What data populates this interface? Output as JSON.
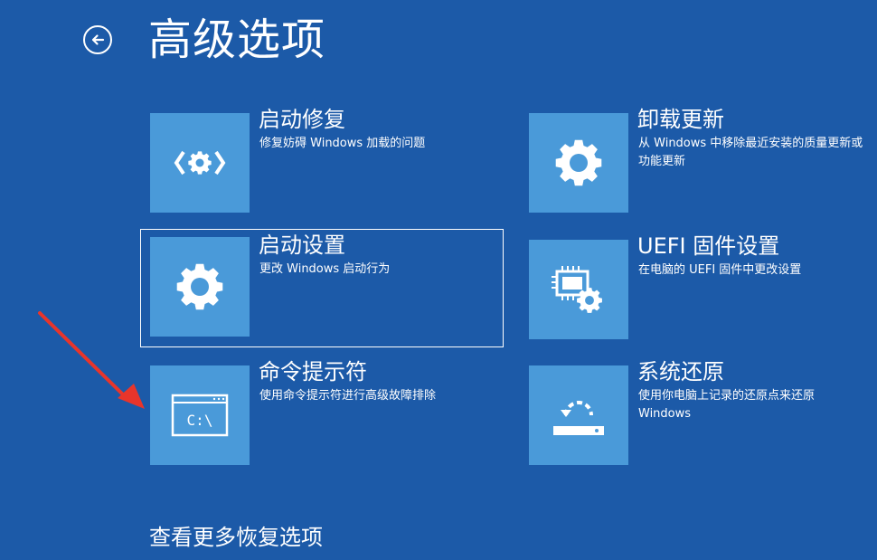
{
  "header": {
    "back_icon": "back-arrow-circle-icon",
    "title": "高级选项"
  },
  "options": [
    {
      "title": "启动修复",
      "desc": "修复妨碍 Windows 加载的问题",
      "icon": "startup-repair-icon"
    },
    {
      "title": "卸载更新",
      "desc": "从 Windows 中移除最近安装的质量更新或功能更新",
      "icon": "gear-icon"
    },
    {
      "title": "启动设置",
      "desc": "更改 Windows 启动行为",
      "icon": "gear-icon"
    },
    {
      "title": "UEFI 固件设置",
      "desc": "在电脑的 UEFI 固件中更改设置",
      "icon": "chip-gear-icon"
    },
    {
      "title": "命令提示符",
      "desc": "使用命令提示符进行高级故障排除",
      "icon": "command-prompt-icon",
      "icon_text": "C:\\"
    },
    {
      "title": "系统还原",
      "desc": "使用你电脑上记录的还原点来还原 Windows",
      "icon": "system-restore-icon"
    }
  ],
  "footer": {
    "more_link": "查看更多恢复选项"
  },
  "colors": {
    "background": "#1c5aa8",
    "tile": "#4a9ad9",
    "text": "#ffffff",
    "annotation_arrow": "#e8352b"
  }
}
